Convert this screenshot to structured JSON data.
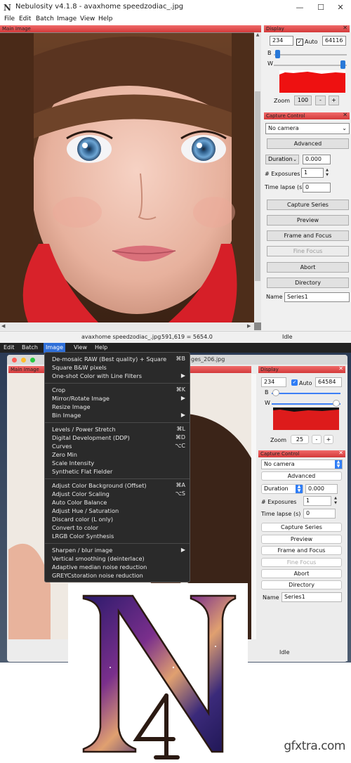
{
  "win": {
    "app_icon": "N",
    "title": "Nebulosity v4.1.8 - avaxhome speedzodiac_.jpg",
    "menu": [
      "File",
      "Edit",
      "Batch",
      "Image",
      "View",
      "Help"
    ],
    "main_image_label": "Main Image",
    "display": {
      "label": "Display",
      "black_value": "234",
      "auto_label": "Auto",
      "white_value": "64116",
      "b_label": "B",
      "w_label": "W",
      "zoom_label": "Zoom",
      "zoom_value": "100",
      "minus": "-",
      "plus": "+"
    },
    "capture": {
      "label": "Capture Control",
      "camera": "No camera",
      "advanced": "Advanced",
      "duration_label": "Duration",
      "duration_value": "0.000",
      "exposures_label": "# Exposures",
      "exposures_value": "1",
      "timelapse_label": "Time lapse (s)",
      "timelapse_value": "0",
      "capture_series": "Capture Series",
      "preview": "Preview",
      "frame_focus": "Frame and Focus",
      "fine_focus": "Fine Focus",
      "abort": "Abort",
      "directory": "Directory",
      "name_label": "Name",
      "name_value": "Series1"
    },
    "status": {
      "file": "avaxhome speedzodiac_.jpg",
      "coords": "591,619 = 5654.0",
      "state": "Idle"
    }
  },
  "mac": {
    "menu": [
      "Edit",
      "Batch",
      "Image",
      "View",
      "Help"
    ],
    "title_suffix": "ges_206.jpg",
    "main_image_label": "Main Image",
    "dropdown": [
      {
        "label": "De-mosaic RAW (Best quality) + Square",
        "shortcut": "⌘B"
      },
      {
        "label": "Square B&W pixels",
        "shortcut": ""
      },
      {
        "label": "One-shot Color with Line Filters",
        "shortcut": "▶"
      },
      {
        "label": "Crop",
        "shortcut": "⌘K"
      },
      {
        "label": "Mirror/Rotate Image",
        "shortcut": "▶"
      },
      {
        "label": "Resize Image",
        "shortcut": ""
      },
      {
        "label": "Bin Image",
        "shortcut": "▶"
      },
      {
        "label": "Levels / Power Stretch",
        "shortcut": "⌘L"
      },
      {
        "label": "Digital Development (DDP)",
        "shortcut": "⌘D"
      },
      {
        "label": "Curves",
        "shortcut": "⌥C"
      },
      {
        "label": "Zero Min",
        "shortcut": ""
      },
      {
        "label": "Scale Intensity",
        "shortcut": ""
      },
      {
        "label": "Synthetic Flat Fielder",
        "shortcut": ""
      },
      {
        "label": "Adjust Color Background (Offset)",
        "shortcut": "⌘A"
      },
      {
        "label": "Adjust Color Scaling",
        "shortcut": "⌥S"
      },
      {
        "label": "Auto Color Balance",
        "shortcut": ""
      },
      {
        "label": "Adjust Hue / Saturation",
        "shortcut": ""
      },
      {
        "label": "Discard color (L only)",
        "shortcut": ""
      },
      {
        "label": "Convert to color",
        "shortcut": ""
      },
      {
        "label": "LRGB Color Synthesis",
        "shortcut": ""
      },
      {
        "label": "Sharpen / blur image",
        "shortcut": "▶"
      },
      {
        "label": "Vertical smoothing (deinterlace)",
        "shortcut": ""
      },
      {
        "label": "Adaptive median noise reduction",
        "shortcut": ""
      },
      {
        "label": "GREYCstoration noise reduction",
        "shortcut": ""
      }
    ],
    "display": {
      "label": "Display",
      "black_value": "234",
      "auto_label": "Auto",
      "white_value": "64584",
      "b_label": "B",
      "w_label": "W",
      "zoom_label": "Zoom",
      "zoom_value": "25",
      "minus": "-",
      "plus": "+"
    },
    "capture": {
      "label": "Capture Control",
      "camera": "No camera",
      "advanced": "Advanced",
      "duration_label": "Duration",
      "duration_value": "0.000",
      "exposures_label": "# Exposures",
      "exposures_value": "1",
      "timelapse_label": "Time lapse (s)",
      "timelapse_value": "0",
      "capture_series": "Capture Series",
      "preview": "Preview",
      "frame_focus": "Frame and Focus",
      "fine_focus": "Fine Focus",
      "abort": "Abort",
      "directory": "Directory",
      "name_label": "Name",
      "name_value": "Series1"
    },
    "status_state": "Idle"
  },
  "logo": {
    "letter": "N",
    "subscript": "4"
  },
  "watermark": "gfxtra.com"
}
